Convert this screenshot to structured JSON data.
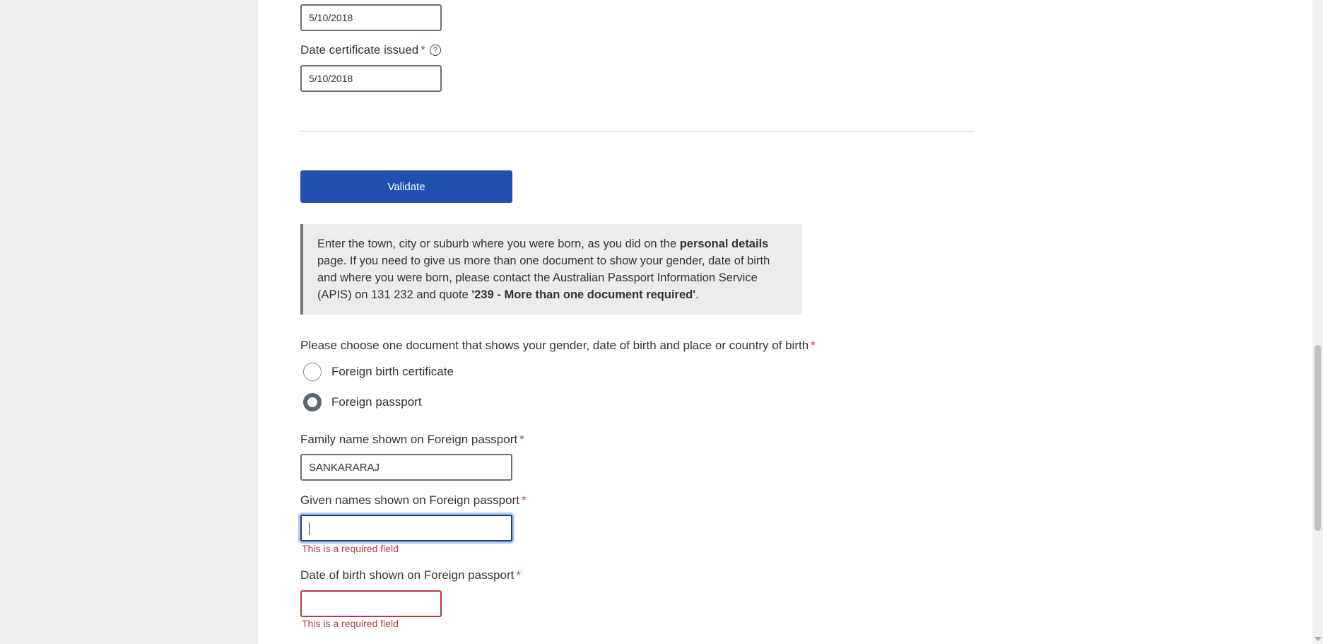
{
  "form": {
    "prev_date_value": "5/10/2018",
    "date_issued": {
      "label": "Date certificate issued",
      "required_mark": "*",
      "help_icon": "?",
      "value": "5/10/2018"
    },
    "validate_button": "Validate",
    "info": {
      "text_1": "Enter the town, city or suburb where you were born, as you did on the ",
      "bold_1": "personal details",
      "text_2": " page. If you need to give us more than one document to show your gender, date of birth and where you were born, please contact the Australian Passport Information Service (APIS) on 131 232 and quote ",
      "bold_2": "'239 - More than one document required'",
      "text_3": "."
    },
    "document_choice": {
      "label": "Please choose one document that shows your gender, date of birth and place or country of birth",
      "required_mark": "*",
      "options": [
        {
          "label": "Foreign birth certificate",
          "checked": false
        },
        {
          "label": "Foreign passport",
          "checked": true
        }
      ]
    },
    "family_name": {
      "label": "Family name shown on Foreign passport",
      "required_mark": "*",
      "value": "SANKARARAJ"
    },
    "given_names": {
      "label": "Given names shown on Foreign passport",
      "required_mark": "*",
      "value": "",
      "error": "This is a required field"
    },
    "date_of_birth": {
      "label": "Date of birth shown on Foreign passport",
      "required_mark": "*",
      "value": "",
      "error": "This is a required field"
    }
  },
  "colors": {
    "primary_button": "#2251b0",
    "error": "#c0393b",
    "focus_border": "#1d3d8f",
    "info_background": "#ececec"
  }
}
